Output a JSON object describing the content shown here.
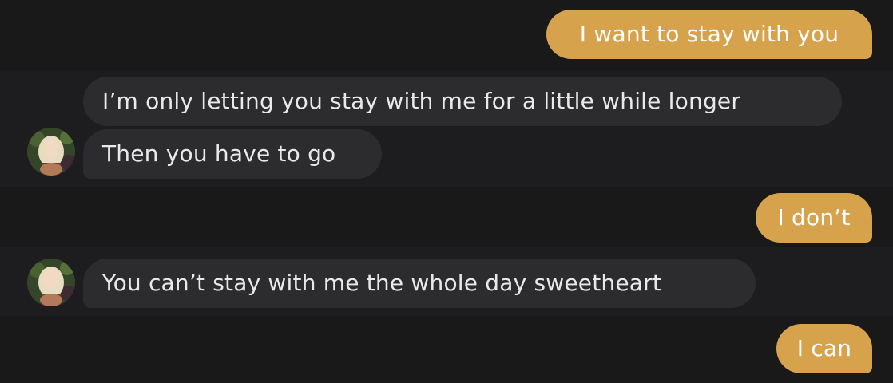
{
  "messages": [
    {
      "id": "m1",
      "sender": "me",
      "text": "I want to stay with you"
    },
    {
      "id": "m2",
      "sender": "contact",
      "text": "I’m only letting you stay with me for a little while longer"
    },
    {
      "id": "m3",
      "sender": "contact",
      "text": "Then you have to go"
    },
    {
      "id": "m4",
      "sender": "me",
      "text": "I don’t"
    },
    {
      "id": "m5",
      "sender": "contact",
      "text": "You can’t stay with me the whole day sweetheart"
    },
    {
      "id": "m6",
      "sender": "me",
      "text": "I can"
    }
  ],
  "colors": {
    "outgoing_bubble": "#d7a24c",
    "incoming_bubble": "#2c2c2f",
    "background": "#19191a",
    "incoming_text": "#e9e9ea",
    "outgoing_text": "#ffffff"
  },
  "avatars": {
    "contact_icon": "contact-avatar-icon"
  }
}
